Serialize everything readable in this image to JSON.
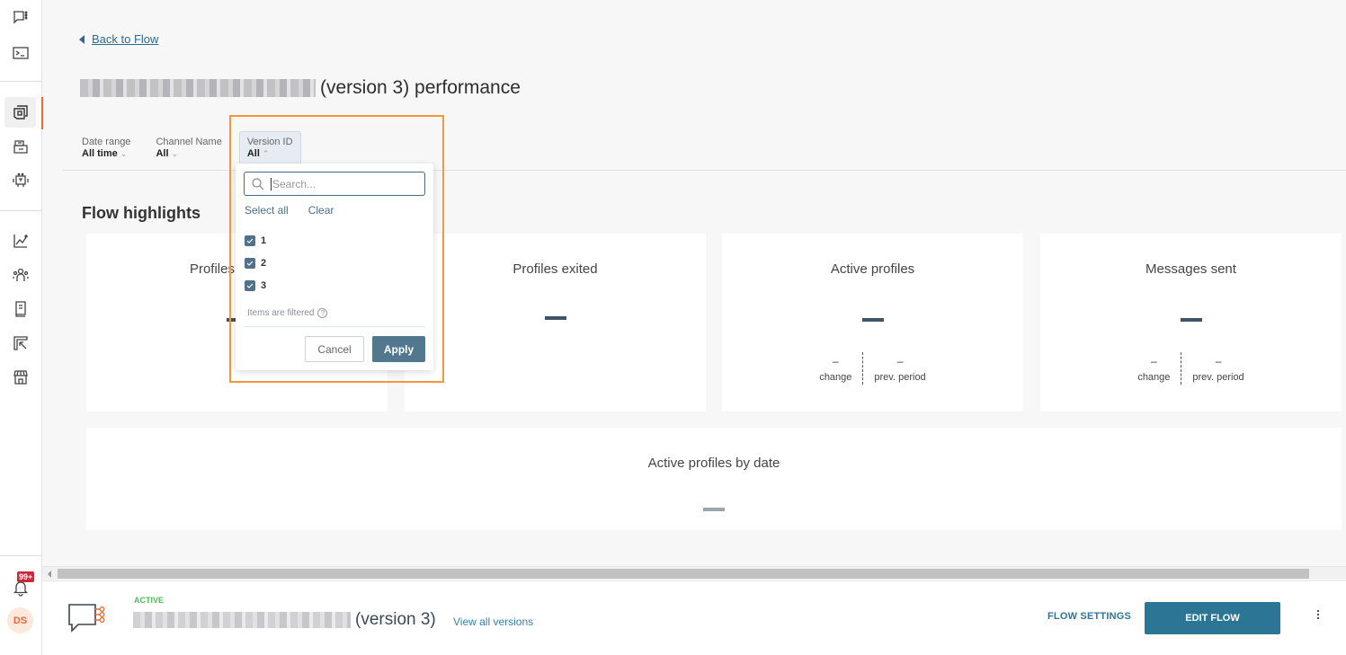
{
  "sidebar": {
    "items": [
      {
        "name": "conversations-icon"
      },
      {
        "name": "terminal-icon"
      },
      {
        "name": "flows-icon",
        "active": true
      },
      {
        "name": "templates-icon"
      },
      {
        "name": "bot-icon"
      },
      {
        "name": "analytics-icon"
      },
      {
        "name": "people-icon"
      },
      {
        "name": "docs-book-icon"
      },
      {
        "name": "exports-icon"
      },
      {
        "name": "store-icon"
      }
    ],
    "notifications_badge": "99+",
    "avatar_initials": "DS"
  },
  "header": {
    "back_link": "Back to Flow",
    "title_suffix": "(version 3) performance"
  },
  "filters": [
    {
      "label": "Date range",
      "value": "All time",
      "open": false
    },
    {
      "label": "Channel Name",
      "value": "All",
      "open": false
    },
    {
      "label": "Version ID",
      "value": "All",
      "open": true
    }
  ],
  "dropdown": {
    "search_placeholder": "Search...",
    "search_value": "",
    "select_all": "Select all",
    "clear": "Clear",
    "options": [
      {
        "label": "1",
        "checked": true
      },
      {
        "label": "2",
        "checked": true
      },
      {
        "label": "3",
        "checked": true
      }
    ],
    "note": "Items are filtered",
    "cancel": "Cancel",
    "apply": "Apply"
  },
  "highlights": {
    "title": "Flow highlights",
    "cards": [
      {
        "title": "Profiles entered",
        "value": "–",
        "change": null,
        "prev_period": null
      },
      {
        "title": "Profiles exited",
        "value": "–",
        "change": null,
        "prev_period": null
      },
      {
        "title": "Active profiles",
        "value": "–",
        "change": "–",
        "change_label": "change",
        "prev_period": "–",
        "prev_label": "prev. period"
      },
      {
        "title": "Messages sent",
        "value": "–",
        "change": "–",
        "change_label": "change",
        "prev_period": "–",
        "prev_label": "prev. period"
      }
    ],
    "chart_card": {
      "title": "Active profiles by date",
      "value": "–"
    }
  },
  "footer": {
    "status": "ACTIVE",
    "flow_name_suffix": "(version 3)",
    "view_versions": "View all versions",
    "flow_settings": "FLOW SETTINGS",
    "edit_flow": "EDIT FLOW"
  },
  "colors": {
    "accent": "#2d7595",
    "active_status": "#4dbb5f",
    "sidebar_active": "#ef6c2a",
    "highlight_border": "#f5963b",
    "badge": "#d0263b"
  }
}
